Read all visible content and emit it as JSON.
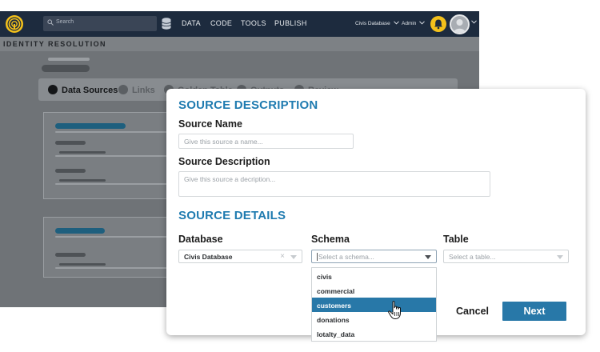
{
  "app": {
    "search_placeholder": "Search",
    "nav": [
      "DATA",
      "CODE",
      "TOOLS",
      "PUBLISH"
    ],
    "database_menu": "Civis Database",
    "admin_menu": "Admin",
    "page_title": "IDENTITY RESOLUTION",
    "steps": [
      {
        "label": "Data Sources",
        "active": true
      },
      {
        "label": "Links",
        "active": false
      },
      {
        "label": "Golden Table",
        "active": false
      },
      {
        "label": "Outputs",
        "active": false
      },
      {
        "label": "Review",
        "active": false
      }
    ],
    "colors": {
      "topbar": "#1d2b3e",
      "accent": "#2878a8",
      "bell": "#f3c11b"
    }
  },
  "modal": {
    "source_description_title": "SOURCE DESCRIPTION",
    "source_name_label": "Source Name",
    "source_name_placeholder": "Give this source a name...",
    "source_description_label": "Source Description",
    "source_description_placeholder": "Give this source a decription...",
    "source_details_title": "SOURCE DETAILS",
    "database_label": "Database",
    "database_value": "Civis Database",
    "schema_label": "Schema",
    "schema_placeholder": "Select a schema...",
    "table_label": "Table",
    "table_placeholder": "Select a table...",
    "schema_options": [
      "civis",
      "commercial",
      "customers",
      "donations",
      "lotalty_data"
    ],
    "highlighted_option": "customers",
    "cancel_label": "Cancel",
    "next_label": "Next",
    "title_color": "#1f7bb0"
  }
}
